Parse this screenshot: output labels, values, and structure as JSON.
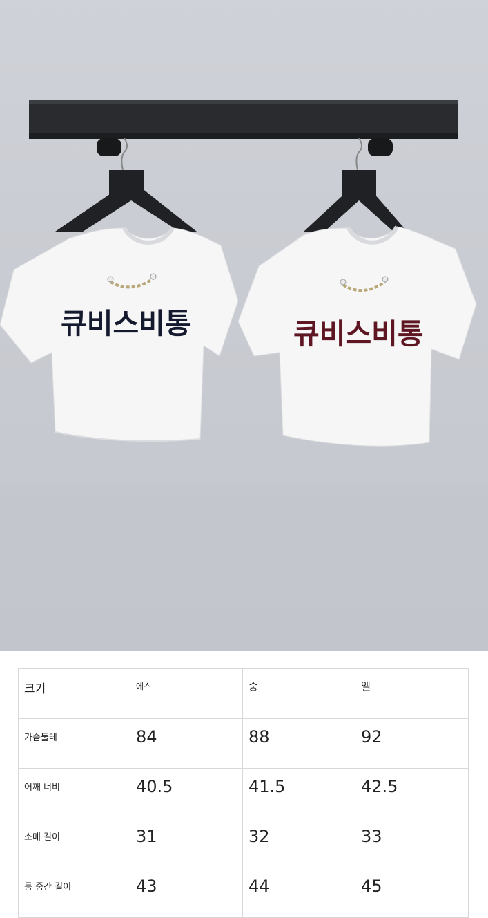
{
  "photo": {
    "shirt_left_text": "큐비스비통",
    "shirt_right_text": "큐비스비통",
    "shirt_left_text_color": "#151a2e",
    "shirt_right_text_color": "#5e1623"
  },
  "size_table": {
    "header": {
      "label": "크기",
      "sizes": [
        "에스",
        "중",
        "엘"
      ]
    },
    "rows": [
      {
        "label": "가슴둘레",
        "values": [
          "84",
          "88",
          "92"
        ]
      },
      {
        "label": "어깨 너비",
        "values": [
          "40.5",
          "41.5",
          "42.5"
        ]
      },
      {
        "label": "소매 길이",
        "values": [
          "31",
          "32",
          "33"
        ]
      },
      {
        "label": "등 중간 길이",
        "values": [
          "43",
          "44",
          "45"
        ]
      }
    ]
  }
}
